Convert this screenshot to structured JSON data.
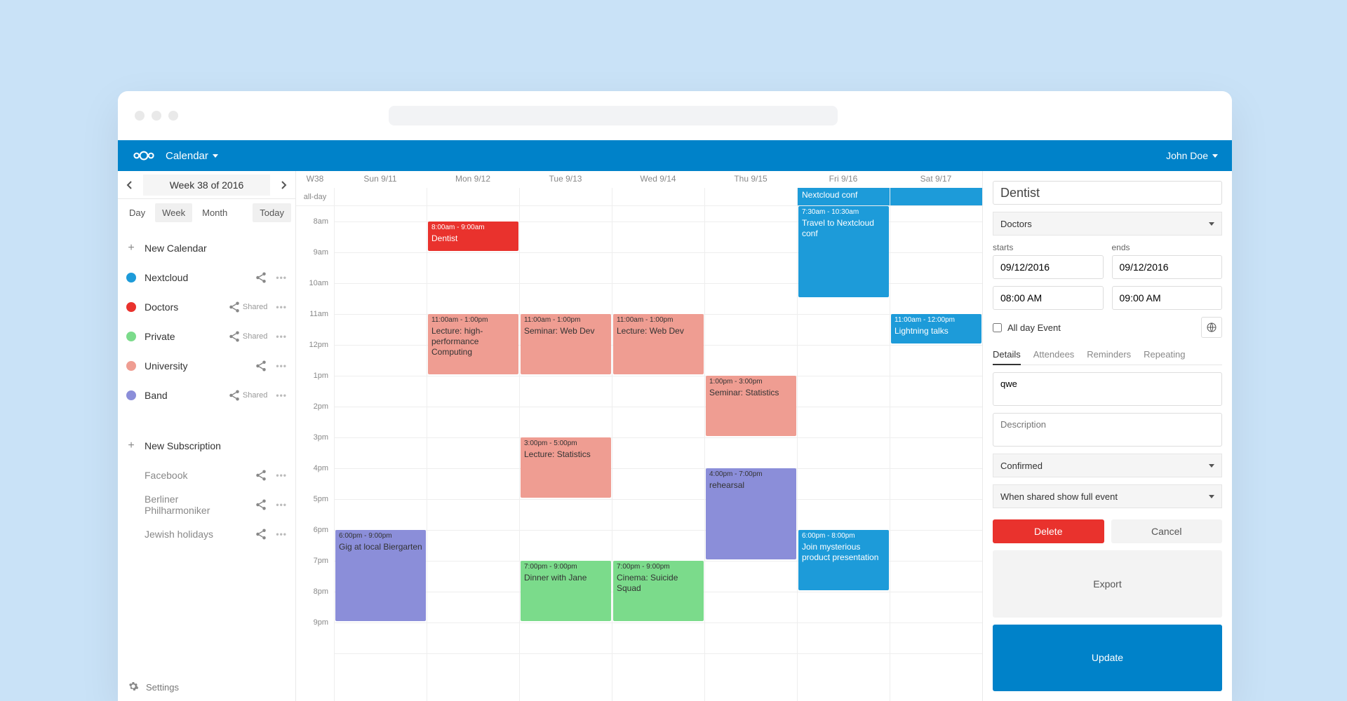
{
  "app": {
    "title": "Calendar",
    "user": "John Doe"
  },
  "nav": {
    "title": "Week 38 of 2016"
  },
  "views": {
    "day": "Day",
    "week": "Week",
    "month": "Month",
    "today": "Today"
  },
  "sidebar": {
    "new_calendar": "New Calendar",
    "calendars": [
      {
        "label": "Nextcloud",
        "color": "#1d9bd9",
        "shared": ""
      },
      {
        "label": "Doctors",
        "color": "#e9322d",
        "shared": "Shared"
      },
      {
        "label": "Private",
        "color": "#7bdb8b",
        "shared": "Shared"
      },
      {
        "label": "University",
        "color": "#ef9d92",
        "shared": ""
      },
      {
        "label": "Band",
        "color": "#8b8ed9",
        "shared": "Shared"
      }
    ],
    "new_subscription": "New Subscription",
    "subs": [
      {
        "label": "Facebook"
      },
      {
        "label": "Berliner Philharmoniker"
      },
      {
        "label": "Jewish holidays"
      }
    ],
    "settings": "Settings"
  },
  "cal": {
    "week_label": "W38",
    "allday_label": "all-day",
    "days": [
      "Sun 9/11",
      "Mon 9/12",
      "Tue 9/13",
      "Wed 9/14",
      "Thu 9/15",
      "Fri 9/16",
      "Sat 9/17"
    ],
    "hours": [
      "8am",
      "9am",
      "10am",
      "11am",
      "12pm",
      "1pm",
      "2pm",
      "3pm",
      "4pm",
      "5pm",
      "6pm",
      "7pm",
      "8pm",
      "9pm"
    ],
    "allday_events": [
      {
        "day": 5,
        "title": "Nextcloud conf",
        "cls": "ev-blue",
        "span": 2
      }
    ],
    "events": [
      {
        "day": 1,
        "start": 8,
        "end": 9,
        "time": "8:00am - 9:00am",
        "title": "Dentist",
        "cls": "ev-red"
      },
      {
        "day": 5,
        "start": 7.5,
        "end": 10.5,
        "time": "7:30am - 10:30am",
        "title": "Travel to Nextcloud conf",
        "cls": "ev-blue"
      },
      {
        "day": 1,
        "start": 11,
        "end": 13,
        "time": "11:00am - 1:00pm",
        "title": "Lecture: high-performance Computing",
        "cls": "ev-salmon"
      },
      {
        "day": 2,
        "start": 11,
        "end": 13,
        "time": "11:00am - 1:00pm",
        "title": "Seminar: Web Dev",
        "cls": "ev-salmon"
      },
      {
        "day": 3,
        "start": 11,
        "end": 13,
        "time": "11:00am - 1:00pm",
        "title": "Lecture: Web Dev",
        "cls": "ev-salmon"
      },
      {
        "day": 6,
        "start": 11,
        "end": 12,
        "time": "11:00am - 12:00pm",
        "title": "Lightning talks",
        "cls": "ev-blue"
      },
      {
        "day": 4,
        "start": 13,
        "end": 15,
        "time": "1:00pm - 3:00pm",
        "title": "Seminar: Statistics",
        "cls": "ev-salmon"
      },
      {
        "day": 2,
        "start": 15,
        "end": 17,
        "time": "3:00pm - 5:00pm",
        "title": "Lecture: Statistics",
        "cls": "ev-salmon"
      },
      {
        "day": 4,
        "start": 16,
        "end": 19,
        "time": "4:00pm - 7:00pm",
        "title": "rehearsal",
        "cls": "ev-purple"
      },
      {
        "day": 0,
        "start": 18,
        "end": 21,
        "time": "6:00pm - 9:00pm",
        "title": "Gig at local Biergarten",
        "cls": "ev-purple"
      },
      {
        "day": 5,
        "start": 18,
        "end": 20,
        "time": "6:00pm - 8:00pm",
        "title": "Join mysterious product presentation",
        "cls": "ev-blue"
      },
      {
        "day": 2,
        "start": 19,
        "end": 21,
        "time": "7:00pm - 9:00pm",
        "title": "Dinner with Jane",
        "cls": "ev-green"
      },
      {
        "day": 3,
        "start": 19,
        "end": 21,
        "time": "7:00pm - 9:00pm",
        "title": "Cinema: Suicide Squad",
        "cls": "ev-green"
      }
    ]
  },
  "details": {
    "title": "Dentist",
    "calendar": "Doctors",
    "starts_lbl": "starts",
    "ends_lbl": "ends",
    "start_date": "09/12/2016",
    "end_date": "09/12/2016",
    "start_time": "08:00 AM",
    "end_time": "09:00 AM",
    "allday_lbl": "All day Event",
    "tabs": {
      "details": "Details",
      "attendees": "Attendees",
      "reminders": "Reminders",
      "repeating": "Repeating"
    },
    "location": "qwe",
    "desc_placeholder": "Description",
    "status": "Confirmed",
    "visibility": "When shared show full event",
    "btn_delete": "Delete",
    "btn_cancel": "Cancel",
    "btn_export": "Export",
    "btn_update": "Update"
  }
}
